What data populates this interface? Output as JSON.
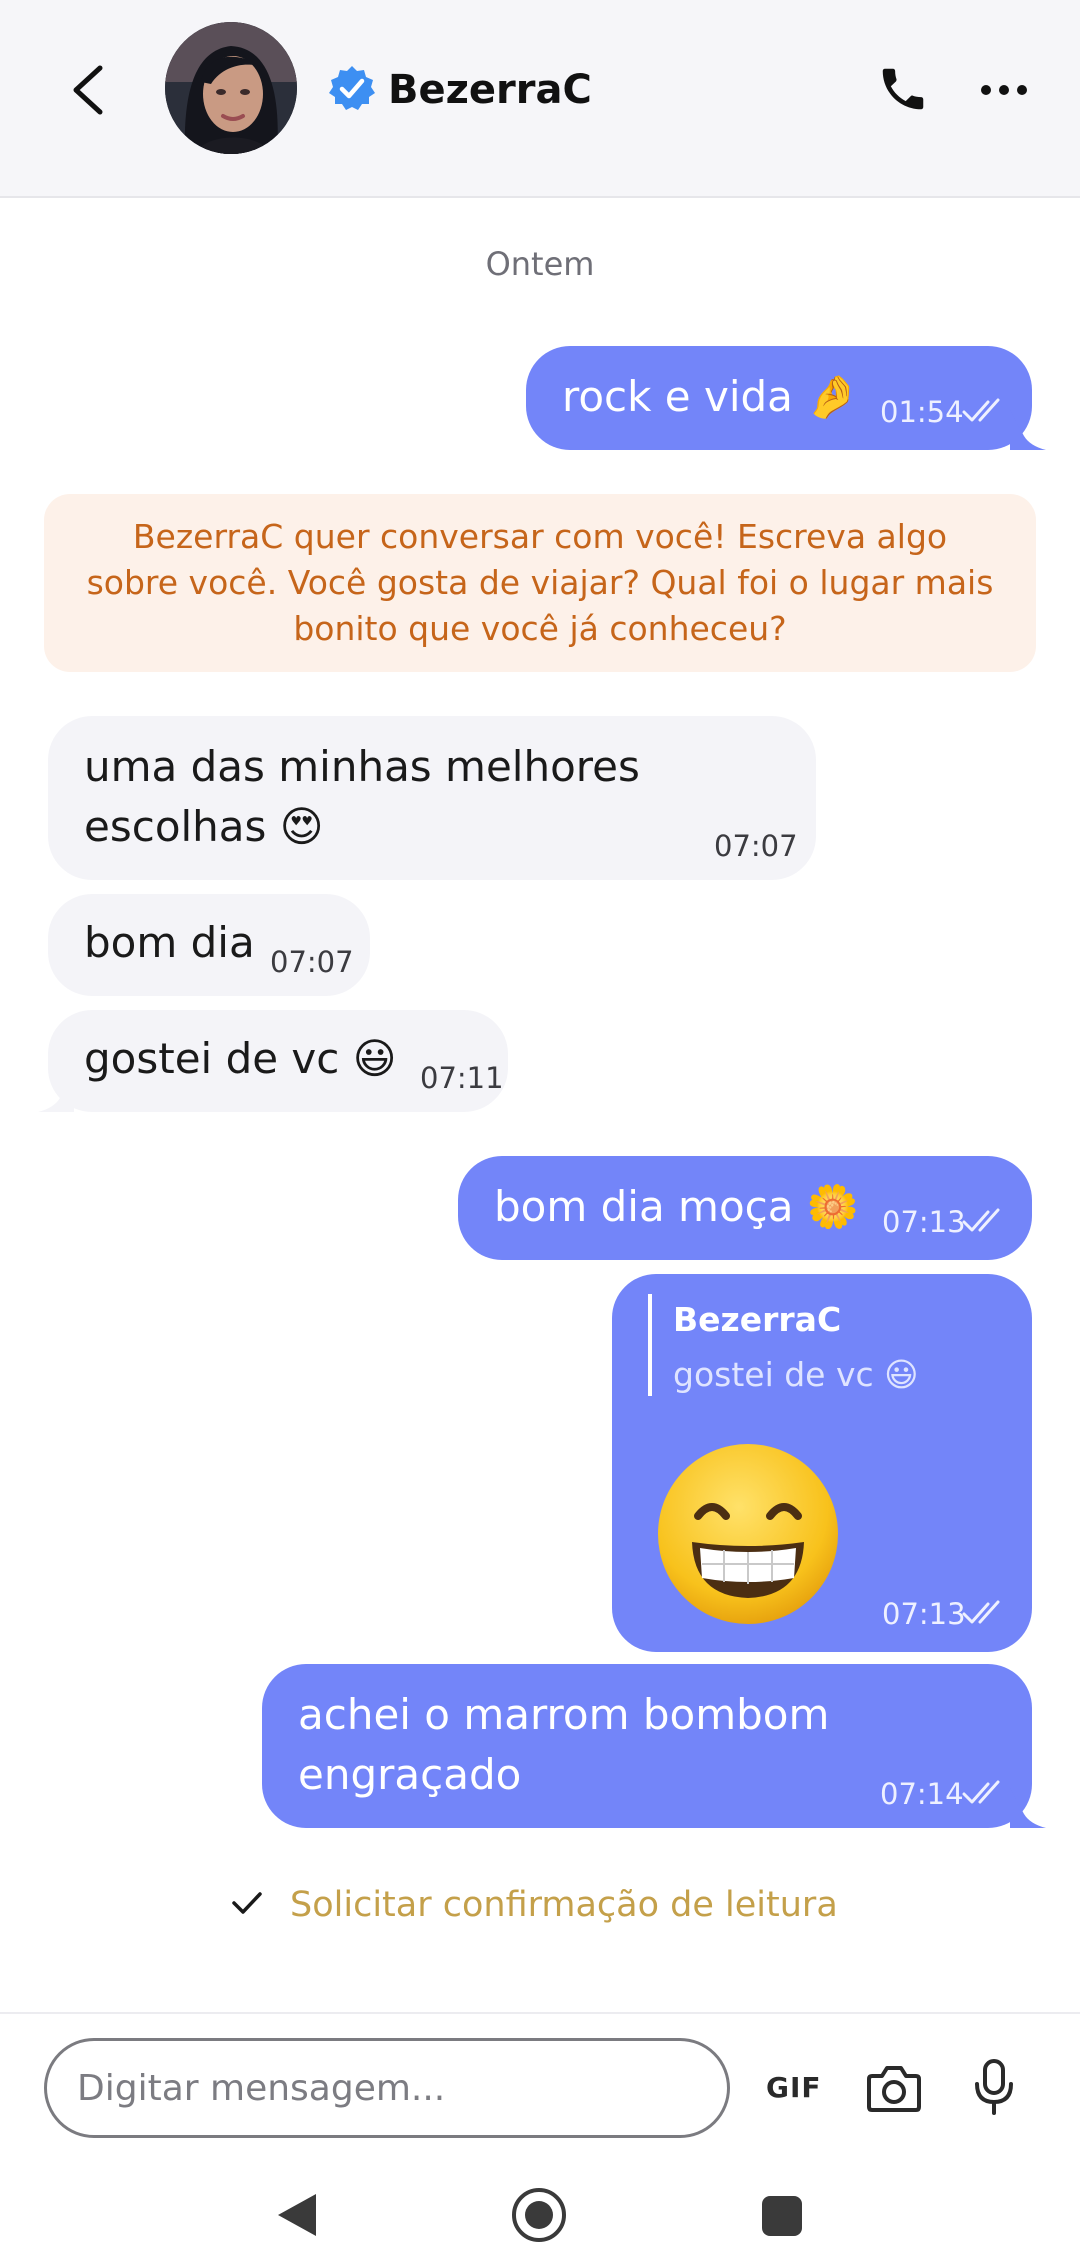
{
  "header": {
    "contact_name": "BezerraC",
    "icons": [
      "back-arrow-icon",
      "verified-badge-icon",
      "phone-icon",
      "more-icon"
    ]
  },
  "chat": {
    "date_separator": "Ontem",
    "system_banner": "BezerraC quer conversar com você! Escreva algo sobre você. Você gosta de viajar? Qual foi o lugar mais bonito que você já conheceu?",
    "messages": [
      {
        "direction": "out",
        "text": "rock e vida 🤌",
        "time": "01:54",
        "read": true
      },
      {
        "direction": "in",
        "lines": [
          "uma das minhas melhores",
          "escolhas 😍"
        ],
        "time": "07:07"
      },
      {
        "direction": "in",
        "text": "bom dia",
        "time": "07:07"
      },
      {
        "direction": "in",
        "text": "gostei de vc 😃",
        "time": "07:11"
      },
      {
        "direction": "out",
        "text": "bom dia moça 🌼",
        "time": "07:13",
        "read": true
      },
      {
        "direction": "out",
        "reply_to": {
          "name": "BezerraC",
          "text": "gostei de vc 😃"
        },
        "emoji": "😁",
        "time": "07:13",
        "read": true
      },
      {
        "direction": "out",
        "lines": [
          "achei o marrom bombom",
          "engraçado"
        ],
        "time": "07:14",
        "read": true
      }
    ],
    "read_receipt_label": "Solicitar confirmação de leitura"
  },
  "composer": {
    "placeholder": "Digitar mensagem...",
    "gif_label": "GIF",
    "icons": [
      "camera-icon",
      "microphone-icon"
    ]
  },
  "colors": {
    "outgoing_bubble": "#7385f9",
    "incoming_bubble": "#f4f4f8",
    "banner_bg": "#fdf1e9",
    "banner_text": "#c6651a",
    "read_receipt_text": "#c4a04a",
    "verified_badge": "#3d8ff2"
  }
}
